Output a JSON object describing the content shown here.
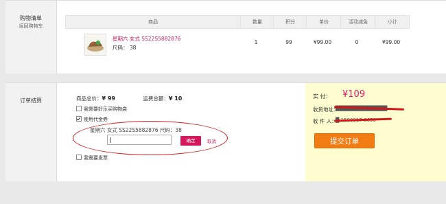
{
  "cart": {
    "title": "购物清单",
    "back_link": "返回购物车",
    "columns": [
      "商品",
      "数量",
      "积分",
      "单价",
      "活动减免",
      "小计"
    ],
    "item": {
      "name": "星期六 女式 SS22S5882876",
      "size": "尺码： 38",
      "quantity": "1",
      "points": "99",
      "unit_price": "¥99.00",
      "discount": "0",
      "subtotal": "¥99.00"
    }
  },
  "order": {
    "title": "订单结算",
    "goods_total_label": "商品总价：",
    "goods_total_value": "¥ 99",
    "shipping_label": "运费总额：",
    "shipping_value": "¥ 10",
    "options": {
      "friend_gift": {
        "label": "我需要好乐买购物袋",
        "checked": false
      },
      "use_voucher": {
        "label": "使用代金券",
        "checked": true
      },
      "invoice": {
        "label": "我需要发票",
        "checked": false
      }
    },
    "voucher_product": "星期六 女式 SS22S5882876 尺码：38",
    "voucher_code": {
      "value": "",
      "placeholder": ""
    },
    "confirm_label": "确定",
    "cancel_label": "取消",
    "annotation_color": "#d42020"
  },
  "payment": {
    "pay_label": "实    付：",
    "pay_amount": "¥109",
    "address_label": "收货地址：",
    "address_value": "██████████████",
    "receiver_label": "收 件 人：",
    "receiver_value": "█ 1500317 6650",
    "submit_label": "提交订单",
    "accent_color": "#e0156e",
    "button_color": "#f27c14"
  }
}
